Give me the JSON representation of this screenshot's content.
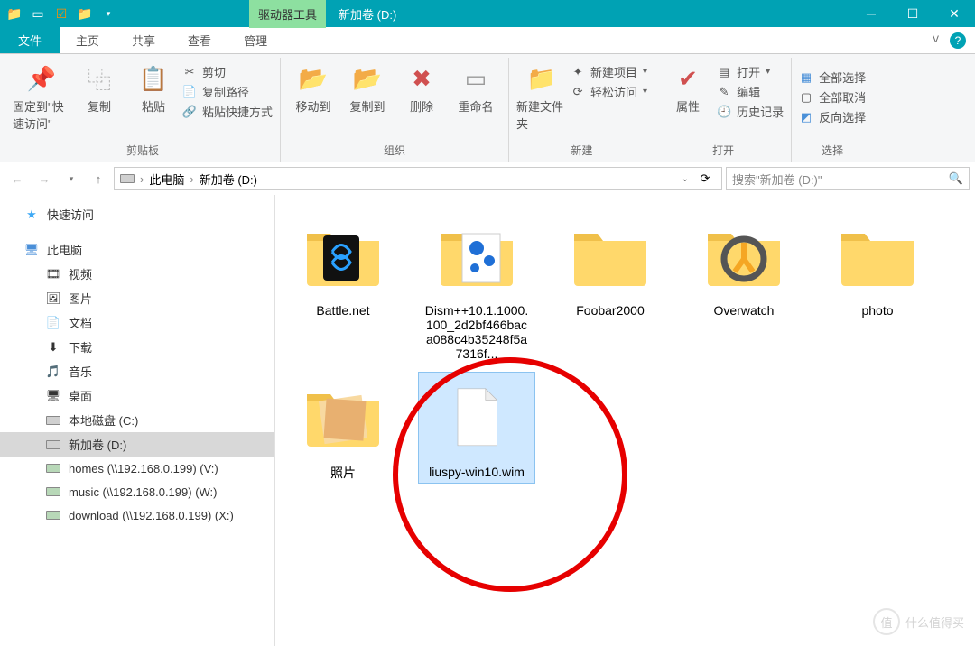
{
  "title": {
    "contextual_tab": "驱动器工具",
    "window_title": "新加卷 (D:)"
  },
  "ribbon_tabs": {
    "file": "文件",
    "home": "主页",
    "share": "共享",
    "view": "查看",
    "manage": "管理"
  },
  "ribbon": {
    "clipboard": {
      "label": "剪贴板",
      "pin": "固定到\"快速访问\"",
      "copy": "复制",
      "paste": "粘贴",
      "cut": "剪切",
      "copy_path": "复制路径",
      "paste_shortcut": "粘贴快捷方式"
    },
    "organize": {
      "label": "组织",
      "move_to": "移动到",
      "copy_to": "复制到",
      "delete": "删除",
      "rename": "重命名"
    },
    "new": {
      "label": "新建",
      "new_folder": "新建文件夹",
      "new_item": "新建项目",
      "easy_access": "轻松访问"
    },
    "open": {
      "label": "打开",
      "properties": "属性",
      "open": "打开",
      "edit": "编辑",
      "history": "历史记录"
    },
    "select": {
      "label": "选择",
      "select_all": "全部选择",
      "select_none": "全部取消",
      "invert": "反向选择"
    }
  },
  "address": {
    "this_pc": "此电脑",
    "location": "新加卷 (D:)",
    "search_placeholder": "搜索\"新加卷 (D:)\""
  },
  "sidebar": {
    "quick_access": "快速访问",
    "this_pc": "此电脑",
    "videos": "视频",
    "pictures": "图片",
    "documents": "文档",
    "downloads": "下载",
    "music": "音乐",
    "desktop": "桌面",
    "local_c": "本地磁盘 (C:)",
    "volume_d": "新加卷 (D:)",
    "homes": "homes (\\\\192.168.0.199) (V:)",
    "music_net": "music (\\\\192.168.0.199) (W:)",
    "download_net": "download (\\\\192.168.0.199) (X:)"
  },
  "files": [
    {
      "name": "Battle.net",
      "type": "folder",
      "variant": "battlenet"
    },
    {
      "name": "Dism++10.1.1000.100_2d2bf466baca088c4b35248f5a7316f...",
      "type": "folder",
      "variant": "gears"
    },
    {
      "name": "Foobar2000",
      "type": "folder",
      "variant": "plain"
    },
    {
      "name": "Overwatch",
      "type": "folder",
      "variant": "overwatch"
    },
    {
      "name": "photo",
      "type": "folder",
      "variant": "plain"
    },
    {
      "name": "照片",
      "type": "folder",
      "variant": "photos"
    },
    {
      "name": "liuspy-win10.wim",
      "type": "file",
      "variant": "blank",
      "selected": true
    }
  ],
  "watermark": "什么值得买"
}
